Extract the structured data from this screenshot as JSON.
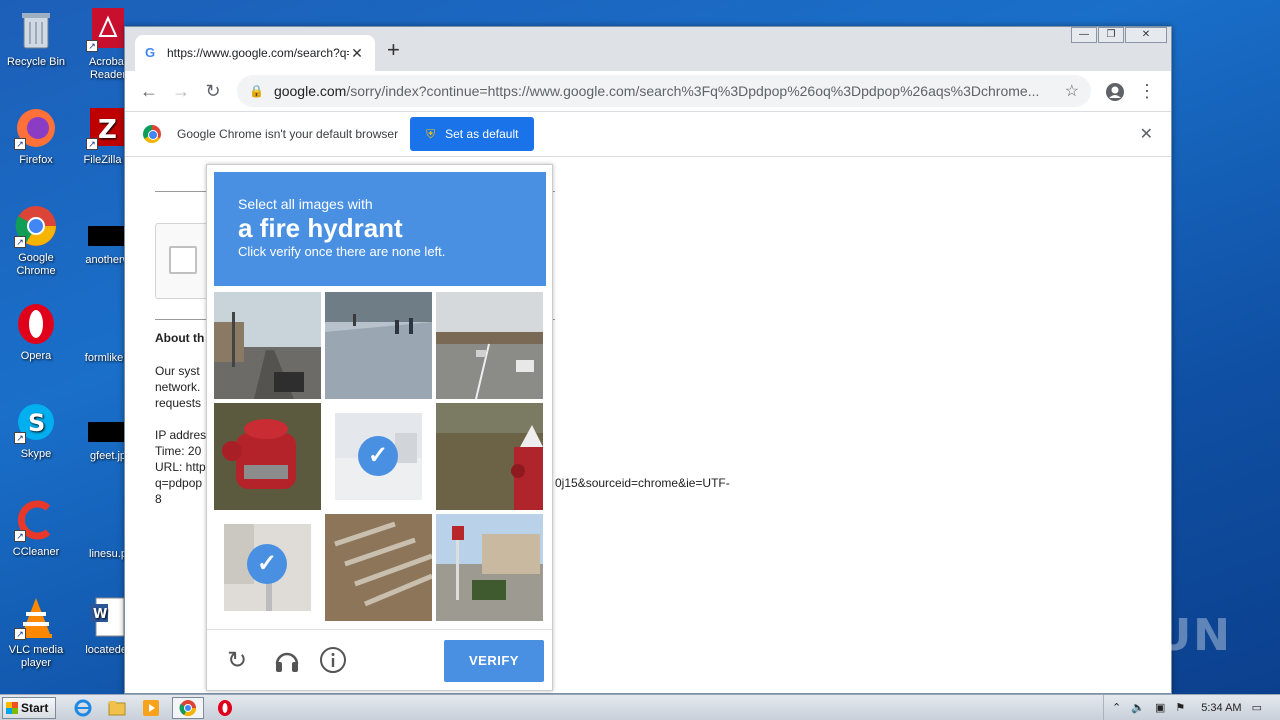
{
  "desktop": {
    "icons": [
      {
        "label": "Recycle Bin"
      },
      {
        "label": "Acrobat Reader"
      },
      {
        "label": "Firefox"
      },
      {
        "label": "FileZilla C"
      },
      {
        "label": "Google Chrome"
      },
      {
        "label": "anotherw"
      },
      {
        "label": "Opera"
      },
      {
        "label": "formlikely"
      },
      {
        "label": "Skype"
      },
      {
        "label": "gfeet.jp"
      },
      {
        "label": "CCleaner"
      },
      {
        "label": "linesu.p"
      },
      {
        "label": "VLC media player"
      },
      {
        "label": "locateder"
      }
    ]
  },
  "browser": {
    "tab_title": "https://www.google.com/search?q=",
    "url_host": "google.com",
    "url_rest": "/sorry/index?continue=https://www.google.com/search%3Fq%3Dpdpop%26oq%3Dpdpop%26aqs%3Dchrome...",
    "infobar_text": "Google Chrome isn't your default browser",
    "set_default_label": "Set as default"
  },
  "page": {
    "about_heading": "About th",
    "para1": [
      "Our syst",
      "network.",
      "requests"
    ],
    "para2": [
      "IP addres",
      "Time: 20",
      "URL: http",
      "q=pdpop",
      "8"
    ],
    "url_tail": "0j15&sourceid=chrome&ie=UTF-"
  },
  "captcha": {
    "line1": "Select all images with",
    "line2": "a fire hydrant",
    "line3": "Click verify once there are none left.",
    "verify_label": "VERIFY",
    "tiles": [
      {
        "name": "street-road-tile",
        "selected": false
      },
      {
        "name": "sidewalk-people-tile",
        "selected": false
      },
      {
        "name": "highway-overpass-tile",
        "selected": false
      },
      {
        "name": "red-hydrant-tile",
        "selected": false
      },
      {
        "name": "faded-tile",
        "selected": true
      },
      {
        "name": "hydrant-grass-tile",
        "selected": false
      },
      {
        "name": "pole-sidewalk-tile",
        "selected": true
      },
      {
        "name": "crosswalk-tile",
        "selected": false
      },
      {
        "name": "gas-station-tile",
        "selected": false
      }
    ]
  },
  "watermark": "ANY RUN",
  "taskbar": {
    "start_label": "Start",
    "clock": "5:34 AM"
  }
}
